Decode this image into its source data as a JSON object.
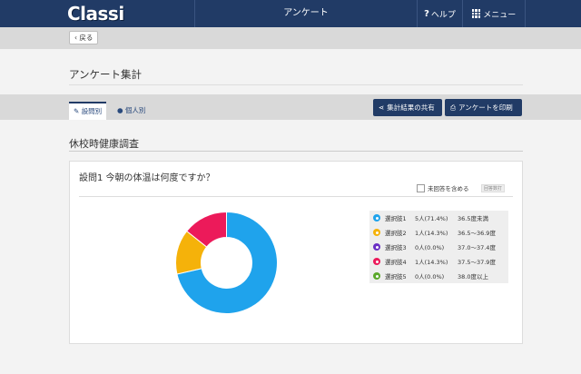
{
  "header": {
    "logo": "Classi",
    "title": "アンケート",
    "help_label": "ヘルプ",
    "menu_label": "メニュー"
  },
  "back_button": "戻る",
  "page_title": "アンケート集計",
  "tabs": [
    {
      "label": "設問別",
      "active": true
    },
    {
      "label": "個人別",
      "active": false
    }
  ],
  "actions": {
    "share_label": "集計結果の共有",
    "print_label": "アンケートを印刷"
  },
  "section_title": "休校時健康調査",
  "question": {
    "title": "設問1  今朝の体温は何度ですか？",
    "include_unanswered_label": "未回答を含める",
    "include_unanswered_checked": false,
    "badge": "回答数打"
  },
  "chart_data": {
    "type": "pie",
    "categories": [
      "選択肢1",
      "選択肢2",
      "選択肢3",
      "選択肢4",
      "選択肢5"
    ],
    "values": [
      5,
      1,
      0,
      1,
      0
    ],
    "counts": [
      "5人(71.4%)",
      "1人(14.3%)",
      "0人(0.0%)",
      "1人(14.3%)",
      "0人(0.0%)"
    ],
    "ranges": [
      "36.5度未満",
      "36.5〜36.9度",
      "37.0〜37.4度",
      "37.5〜37.9度",
      "38.0度以上"
    ],
    "colors": [
      "#1fa3ec",
      "#f5b20a",
      "#6a2fc4",
      "#ec1a5a",
      "#5aa82a"
    ],
    "donut": true
  }
}
